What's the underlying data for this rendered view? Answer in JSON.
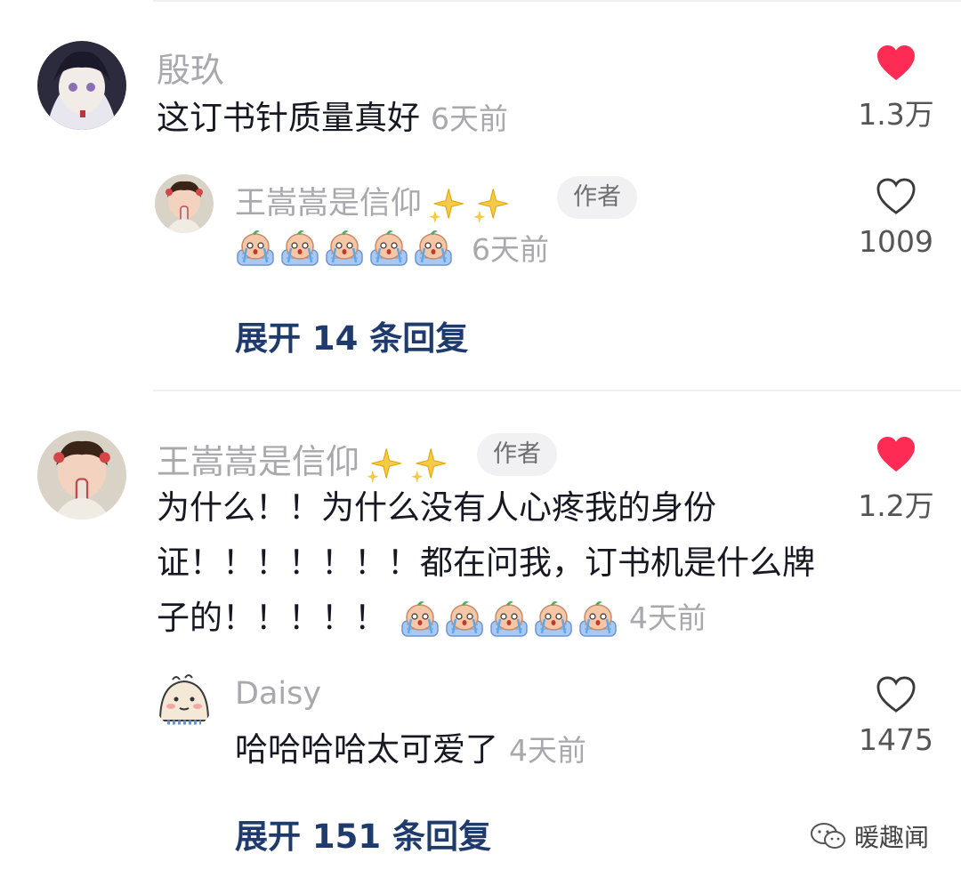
{
  "comments": [
    {
      "user": "殷玖",
      "text": "这订书针质量真好",
      "time": "6天前",
      "likes": "1.3万",
      "liked": true,
      "reply": {
        "user": "王嵩嵩是信仰",
        "author_tag": "作者",
        "time": "6天前",
        "likes": "1009",
        "liked": false
      },
      "expand_label": "展开 14 条回复"
    },
    {
      "user": "王嵩嵩是信仰",
      "author_tag": "作者",
      "text_lines": [
        "为什么！！为什么没有人心疼我的身份",
        "证！！！！！！！都在问我，订书机是什么牌",
        "子的！！！！！"
      ],
      "time": "4天前",
      "likes": "1.2万",
      "liked": true,
      "reply": {
        "user": "Daisy",
        "text": "哈哈哈哈太可爱了",
        "time": "4天前",
        "likes": "1475",
        "liked": false
      },
      "expand_label": "展开 151 条回复"
    }
  ],
  "watermark": "暖趣闻",
  "colors": {
    "like_red": "#fe2c55",
    "link_blue": "#1f3b6e",
    "meta_gray": "#a8a8ad"
  }
}
